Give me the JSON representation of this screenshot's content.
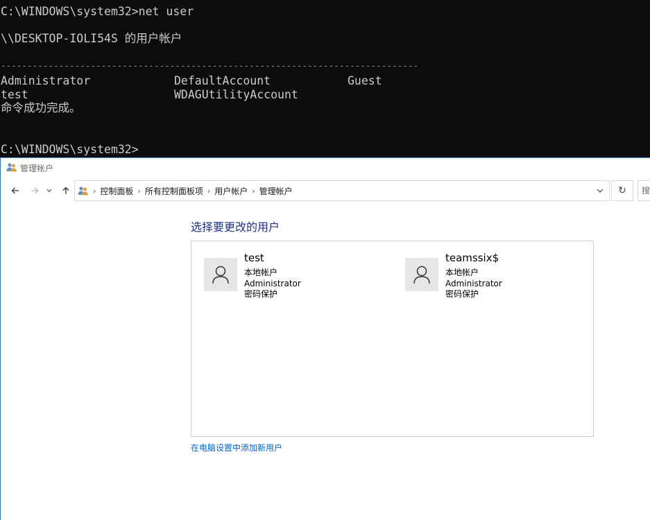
{
  "cmd": {
    "line1": "C:\\WINDOWS\\system32>net user",
    "line2": "\\\\DESKTOP-IOLI54S 的用户帐户",
    "separator": "-------------------------------------------------------------------------------",
    "accounts_row1": [
      "Administrator",
      "DefaultAccount",
      "Guest"
    ],
    "accounts_row2": [
      "test",
      "WDAGUtilityAccount"
    ],
    "completion": "命令成功完成。",
    "prompt": "C:\\WINDOWS\\system32>"
  },
  "window": {
    "title": "管理帐户",
    "title_icon": "users-icon"
  },
  "nav": {
    "back_icon": "back-arrow-icon",
    "forward_icon": "forward-arrow-icon",
    "recent_icon": "chevron-down-icon",
    "up_icon": "up-arrow-icon",
    "breadcrumbs": [
      "控制面板",
      "所有控制面板项",
      "用户帐户",
      "管理帐户"
    ],
    "search_placeholder": "搜"
  },
  "main": {
    "heading": "选择要更改的用户",
    "users": [
      {
        "name": "test",
        "type": "本地帐户",
        "group": "Administrator",
        "protection": "密码保护"
      },
      {
        "name": "teamssix$",
        "type": "本地帐户",
        "group": "Administrator",
        "protection": "密码保护"
      }
    ],
    "add_user_link": "在电脑设置中添加新用户"
  },
  "colors": {
    "console_bg": "#0c0c0c",
    "console_text": "#cccccc",
    "heading": "#1e3287",
    "link": "#0066cc"
  }
}
